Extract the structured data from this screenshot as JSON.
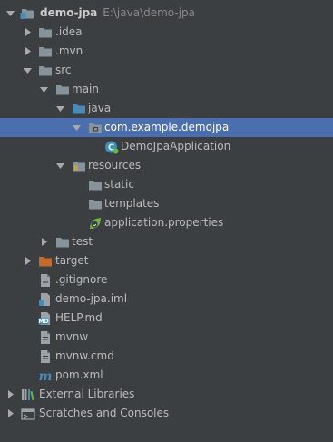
{
  "project": {
    "root": {
      "label": "demo-jpa",
      "path": "E:\\java\\demo-jpa"
    },
    "items": [
      {
        "label": ".idea"
      },
      {
        "label": ".mvn"
      },
      {
        "label": "src"
      },
      {
        "label": "main"
      },
      {
        "label": "java"
      },
      {
        "label": "com.example.demojpa"
      },
      {
        "label": "DemoJpaApplication"
      },
      {
        "label": "resources"
      },
      {
        "label": "static"
      },
      {
        "label": "templates"
      },
      {
        "label": "application.properties"
      },
      {
        "label": "test"
      },
      {
        "label": "target"
      },
      {
        "label": ".gitignore"
      },
      {
        "label": "demo-jpa.iml"
      },
      {
        "label": "HELP.md"
      },
      {
        "label": "mvnw"
      },
      {
        "label": "mvnw.cmd"
      },
      {
        "label": "pom.xml"
      },
      {
        "label": "External Libraries"
      },
      {
        "label": "Scratches and Consoles"
      }
    ]
  },
  "colors": {
    "background": "#3c3f41",
    "selection": "#4b6eaf",
    "folder": "#87939a",
    "source_folder": "#4a8ab7",
    "excluded_folder": "#c46a2e"
  }
}
